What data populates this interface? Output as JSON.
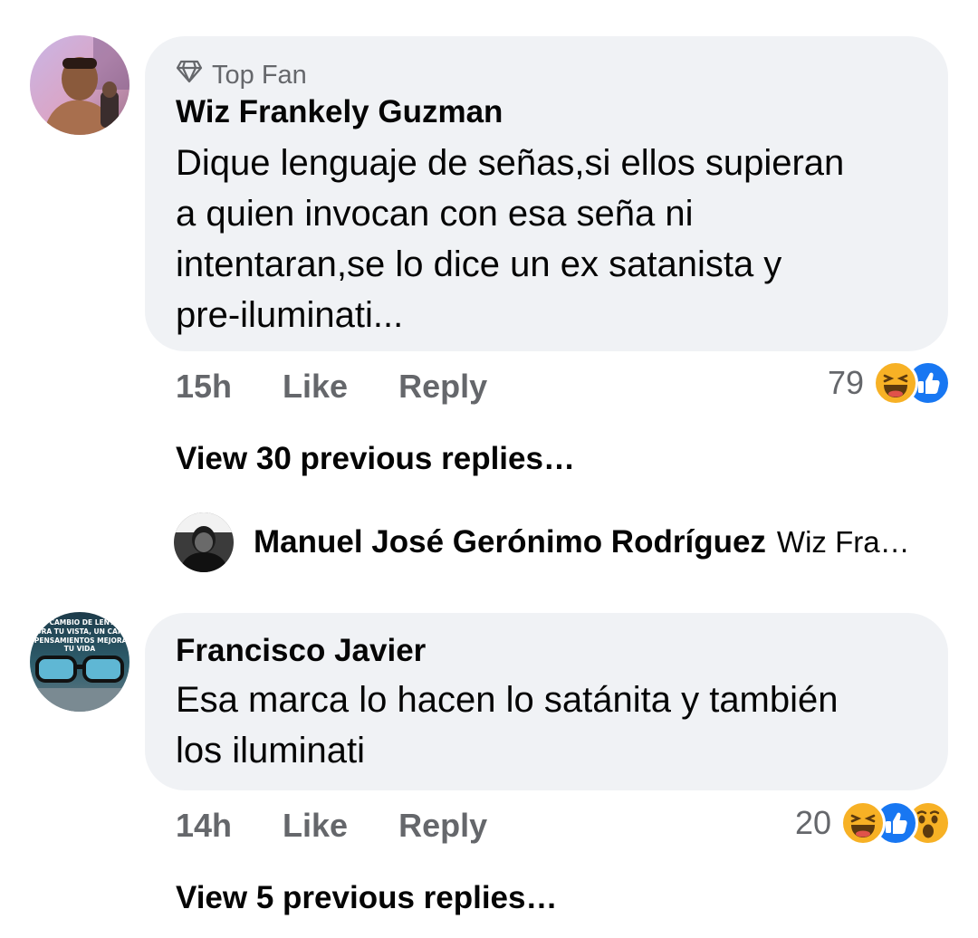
{
  "comments": [
    {
      "badge": "Top Fan",
      "author": "Wiz Frankely Guzman",
      "lines": [
        "Dique lenguaje de señas,si ellos supieran",
        "a quien invocan con esa seña ni",
        "intentaran,se lo dice un ex satanista y",
        "pre-iluminati..."
      ],
      "time": "15h",
      "like_label": "Like",
      "reply_label": "Reply",
      "reaction_count": "79",
      "reactions": [
        "haha-icon",
        "like-icon"
      ],
      "view_replies": "View 30 previous replies…",
      "latest_reply": {
        "author": "Manuel José Gerónimo Rodríguez",
        "snippet": "Wiz Fra…"
      }
    },
    {
      "author": "Francisco Javier",
      "avatar_text": "UN CAMBIO DE LENTES MEJORA TU VISTA, UN CAMBIO DE PENSAMIENTOS MEJORARA TU VIDA",
      "lines": [
        "Esa marca lo hacen lo satánita y también",
        "los iluminati"
      ],
      "time": "14h",
      "like_label": "Like",
      "reply_label": "Reply",
      "reaction_count": "20",
      "reactions": [
        "haha-icon",
        "like-icon",
        "wow-icon"
      ],
      "view_replies": "View 5 previous replies…"
    }
  ],
  "colors": {
    "bubble": "#f0f2f5",
    "meta_text": "#65676b",
    "like_blue": "#1877f2",
    "emoji_yellow": "#f7b125"
  }
}
